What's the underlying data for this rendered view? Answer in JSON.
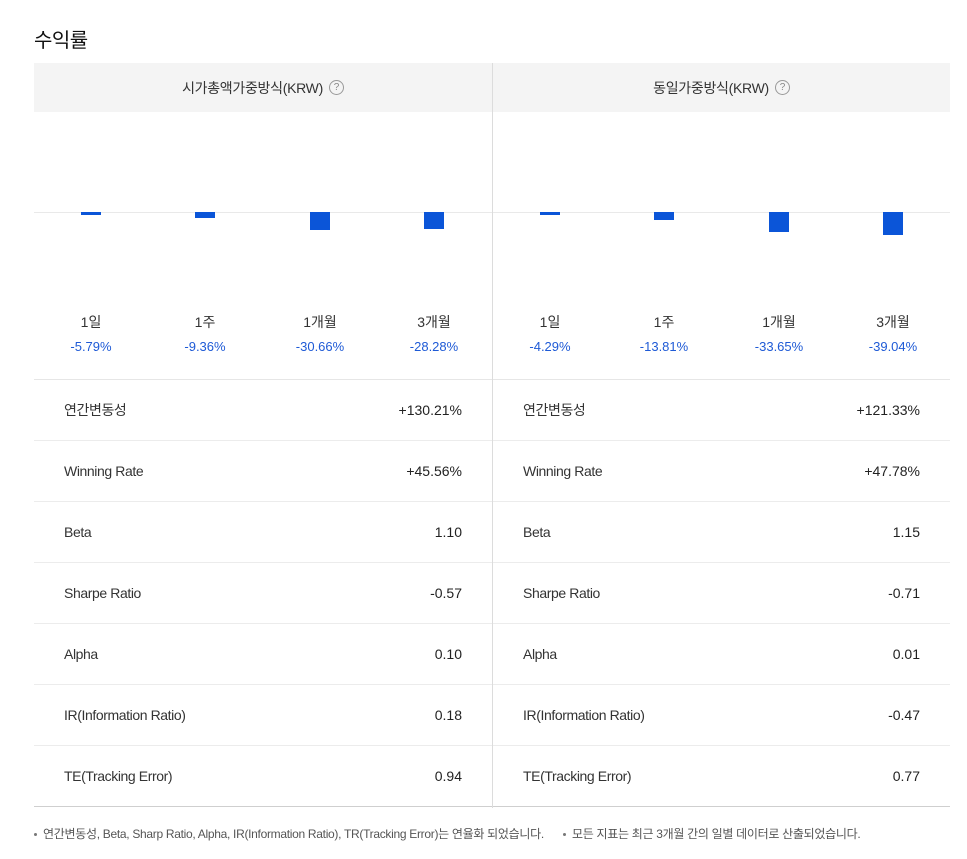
{
  "section_title": "수익률",
  "panels": [
    {
      "title": "시가총액가중방식(KRW)",
      "help_icon": "question-circle-icon",
      "bar_color": "#0b55d8",
      "returns": [
        {
          "period": "1일",
          "value": "-5.79%",
          "num": -5.79
        },
        {
          "period": "1주",
          "value": "-9.36%",
          "num": -9.36
        },
        {
          "period": "1개월",
          "value": "-30.66%",
          "num": -30.66
        },
        {
          "period": "3개월",
          "value": "-28.28%",
          "num": -28.28
        }
      ],
      "stats": [
        {
          "label": "연간변동성",
          "value": "+130.21%"
        },
        {
          "label": "Winning Rate",
          "value": "+45.56%"
        },
        {
          "label": "Beta",
          "value": "1.10"
        },
        {
          "label": "Sharpe Ratio",
          "value": "-0.57"
        },
        {
          "label": "Alpha",
          "value": "0.10"
        },
        {
          "label": "IR(Information Ratio)",
          "value": "0.18"
        },
        {
          "label": "TE(Tracking Error)",
          "value": "0.94"
        }
      ]
    },
    {
      "title": "동일가중방식(KRW)",
      "help_icon": "question-circle-icon",
      "bar_color": "#0b55d8",
      "returns": [
        {
          "period": "1일",
          "value": "-4.29%",
          "num": -4.29
        },
        {
          "period": "1주",
          "value": "-13.81%",
          "num": -13.81
        },
        {
          "period": "1개월",
          "value": "-33.65%",
          "num": -33.65
        },
        {
          "period": "3개월",
          "value": "-39.04%",
          "num": -39.04
        }
      ],
      "stats": [
        {
          "label": "연간변동성",
          "value": "+121.33%"
        },
        {
          "label": "Winning Rate",
          "value": "+47.78%"
        },
        {
          "label": "Beta",
          "value": "1.15"
        },
        {
          "label": "Sharpe Ratio",
          "value": "-0.71"
        },
        {
          "label": "Alpha",
          "value": "0.01"
        },
        {
          "label": "IR(Information Ratio)",
          "value": "-0.47"
        },
        {
          "label": "TE(Tracking Error)",
          "value": "0.77"
        }
      ]
    }
  ],
  "footnotes": [
    "연간변동성, Beta, Sharp Ratio, Alpha, IR(Information Ratio), TR(Tracking Error)는 연율화 되었습니다.",
    "모든 지표는 최근 3개월 간의 일별 데이터로 산출되었습니다."
  ]
}
